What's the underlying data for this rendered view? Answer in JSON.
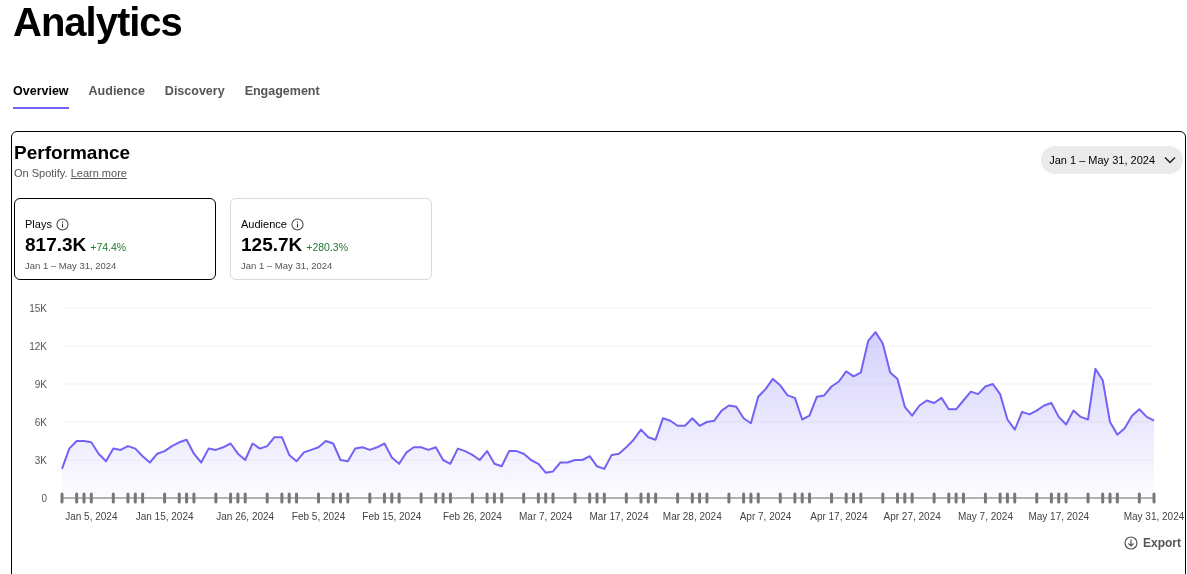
{
  "page": {
    "title": "Analytics"
  },
  "tabs": [
    {
      "label": "Overview",
      "selected": true
    },
    {
      "label": "Audience",
      "selected": false
    },
    {
      "label": "Discovery",
      "selected": false
    },
    {
      "label": "Engagement",
      "selected": false
    }
  ],
  "performance": {
    "title": "Performance",
    "subtitle": "On Spotify.",
    "link": "Learn more",
    "date_range": "Jan 1 – May 31, 2024",
    "metrics": [
      {
        "label": "Plays",
        "value": "817.3K",
        "change": "+74.4%",
        "period": "Jan 1 – May 31, 2024",
        "selected": true
      },
      {
        "label": "Audience",
        "value": "125.7K",
        "change": "+280.3%",
        "period": "Jan 1 – May 31, 2024",
        "selected": false
      }
    ],
    "chart_data": {
      "type": "area",
      "grid": true,
      "ylim": [
        0,
        15000
      ],
      "categories": [
        null,
        null,
        null,
        null,
        "Jan 5, 2024",
        null,
        null,
        null,
        null,
        null,
        null,
        null,
        null,
        null,
        "Jan 15, 2024",
        null,
        null,
        null,
        null,
        null,
        null,
        null,
        null,
        null,
        null,
        "Jan 26, 2024",
        null,
        null,
        null,
        null,
        null,
        null,
        null,
        null,
        null,
        "Feb 5, 2024",
        null,
        null,
        null,
        null,
        null,
        null,
        null,
        null,
        null,
        "Feb 15, 2024",
        null,
        null,
        null,
        null,
        null,
        null,
        null,
        null,
        null,
        null,
        "Feb 26, 2024",
        null,
        null,
        null,
        null,
        null,
        null,
        null,
        null,
        null,
        "Mar 7, 2024",
        null,
        null,
        null,
        null,
        null,
        null,
        null,
        null,
        null,
        "Mar 17, 2024",
        null,
        null,
        null,
        null,
        null,
        null,
        null,
        null,
        null,
        "Mar 28, 2024",
        null,
        null,
        null,
        null,
        null,
        null,
        null,
        null,
        null,
        "Apr 7, 2024",
        null,
        null,
        null,
        null,
        null,
        null,
        null,
        null,
        null,
        "Apr 17, 2024",
        null,
        null,
        null,
        null,
        null,
        null,
        null,
        null,
        null,
        "Apr 27, 2024",
        null,
        null,
        null,
        null,
        null,
        null,
        null,
        null,
        null,
        "May 7, 2024",
        null,
        null,
        null,
        null,
        null,
        null,
        null,
        null,
        null,
        "May 17, 2024",
        null,
        null,
        null,
        null,
        null,
        null,
        null,
        null,
        null,
        null,
        null,
        null,
        "May 31, 2024"
      ],
      "yticks": [
        {
          "value": 0,
          "label": "0"
        },
        {
          "value": 3000,
          "label": "3K"
        },
        {
          "value": 6000,
          "label": "6K"
        },
        {
          "value": 9000,
          "label": "9K"
        },
        {
          "value": 12000,
          "label": "12K"
        },
        {
          "value": 15000,
          "label": "15K"
        }
      ],
      "series": [
        {
          "color": "#7363f5",
          "values": [
            2300,
            3900,
            4500,
            4500,
            4400,
            3500,
            2900,
            3900,
            3800,
            4100,
            3900,
            3300,
            2800,
            3500,
            3700,
            4100,
            4400,
            4600,
            3500,
            2800,
            3900,
            3800,
            4000,
            4300,
            3500,
            3000,
            4300,
            3900,
            4100,
            4800,
            4800,
            3400,
            2900,
            3600,
            3800,
            4000,
            4500,
            4300,
            3000,
            2900,
            3900,
            4000,
            3800,
            4000,
            4300,
            3200,
            2700,
            3600,
            4000,
            4000,
            3800,
            4000,
            3000,
            2700,
            3900,
            3700,
            3400,
            3000,
            3700,
            2700,
            2500,
            3700,
            3700,
            3500,
            3000,
            2700,
            2000,
            2100,
            2800,
            2800,
            3000,
            3000,
            3300,
            2500,
            2300,
            3400,
            3500,
            4000,
            4600,
            5400,
            4800,
            4600,
            6300,
            6100,
            5700,
            5700,
            6300,
            5700,
            6000,
            6100,
            6900,
            7300,
            7200,
            6300,
            5900,
            8000,
            8600,
            9400,
            8900,
            8100,
            7900,
            6200,
            6500,
            8000,
            8100,
            8800,
            9200,
            10000,
            9600,
            9900,
            12400,
            13100,
            12200,
            9900,
            9400,
            7200,
            6500,
            7300,
            7700,
            7500,
            7900,
            7000,
            7000,
            7700,
            8400,
            8200,
            8800,
            9000,
            8200,
            6200,
            5400,
            6800,
            6600,
            6900,
            7300,
            7500,
            6400,
            5800,
            6900,
            6400,
            6200,
            10200,
            9300,
            6000,
            5000,
            5500,
            6500,
            7000,
            6400,
            6100
          ]
        }
      ]
    },
    "export": "Export"
  }
}
